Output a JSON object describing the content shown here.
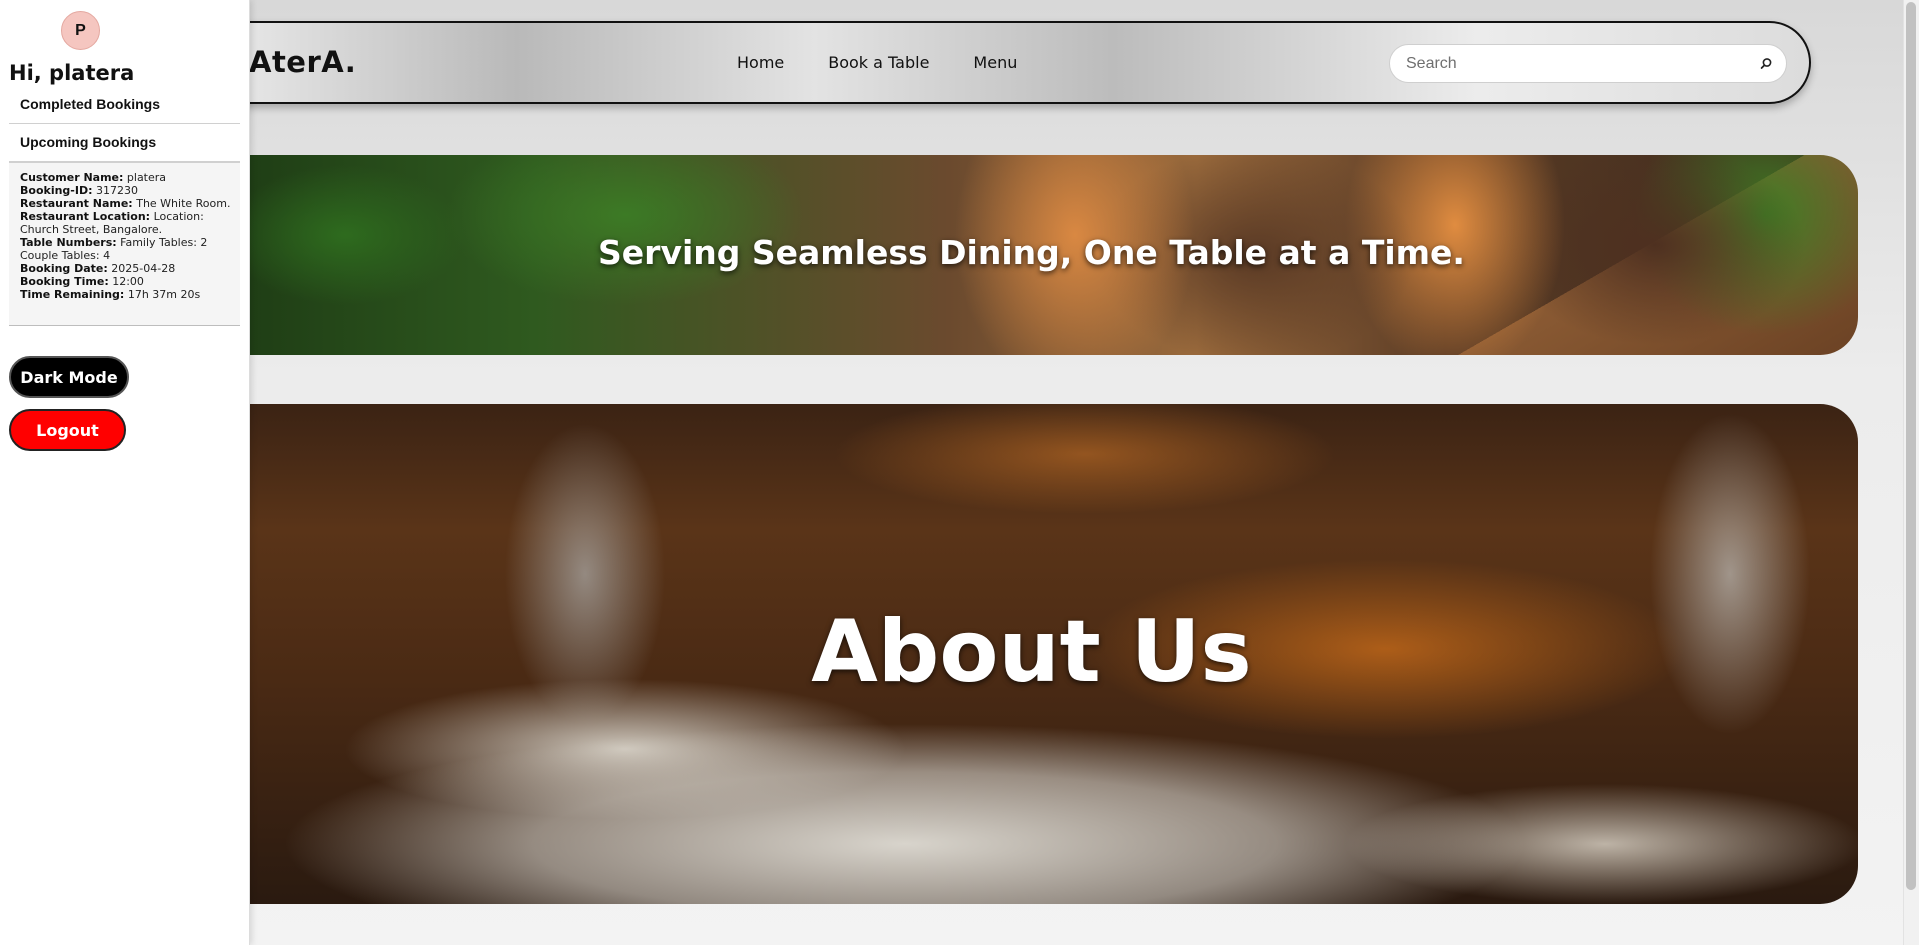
{
  "brand": "AterA.",
  "nav": {
    "links": [
      "Home",
      "Book a Table",
      "Menu"
    ]
  },
  "search": {
    "placeholder": "Search",
    "value": "",
    "icon": "search-icon"
  },
  "hero": {
    "tagline": "Serving Seamless Dining, One Table at a Time.",
    "about_title": "About Us"
  },
  "sidebar": {
    "avatar_initial": "P",
    "greeting": "Hi, platera",
    "completed_label": "Completed Bookings",
    "upcoming_label": "Upcoming Bookings",
    "booking": {
      "customer_name_label": "Customer Name:",
      "customer_name": "platera",
      "booking_id_label": "Booking-ID:",
      "booking_id": "317230",
      "restaurant_name_label": "Restaurant Name:",
      "restaurant_name": "The White Room.",
      "restaurant_location_label": "Restaurant Location:",
      "restaurant_location": "Location: Church Street, Bangalore.",
      "table_numbers_label": "Table Numbers:",
      "table_numbers": "Family Tables: 2 Couple Tables: 4",
      "booking_date_label": "Booking Date:",
      "booking_date": "2025-04-28",
      "booking_time_label": "Booking Time:",
      "booking_time": "12:00",
      "time_remaining_label": "Time Remaining:",
      "time_remaining": "17h 37m 20s"
    },
    "dark_mode_label": "Dark Mode",
    "logout_label": "Logout"
  },
  "colors": {
    "logout_bg": "#ff0000",
    "dark_mode_bg": "#000000",
    "avatar_bg": "#f5c6c0"
  }
}
